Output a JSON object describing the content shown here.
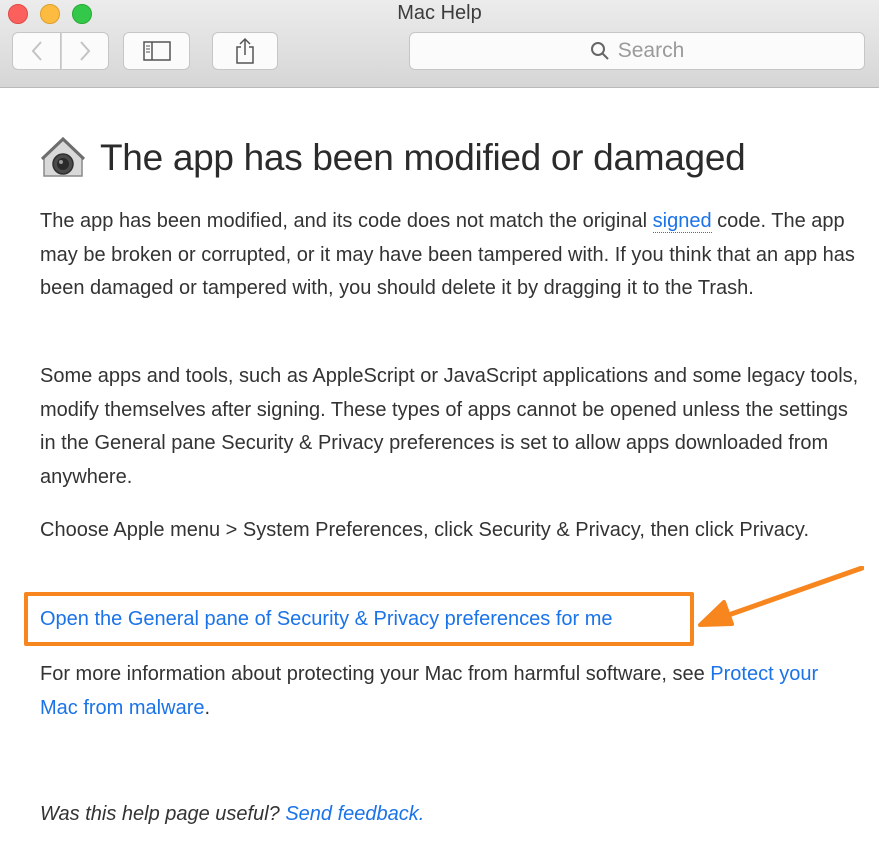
{
  "window": {
    "title": "Mac Help"
  },
  "toolbar": {
    "back_icon": "chevron-left-icon",
    "forward_icon": "chevron-right-icon",
    "sidebar_icon": "sidebar-icon",
    "share_icon": "share-icon",
    "search_placeholder": "Search"
  },
  "article": {
    "title": "The app has been modified or damaged",
    "title_icon": "gatekeeper-lock-icon",
    "p1_before": "The app has been modified, and its code does not match the original ",
    "p1_link": "signed",
    "p1_after": " code. The app may be broken or corrupted, or it may have been tampered with. If you think that an app has been damaged or tampered with, you should delete it by dragging it to the Trash.",
    "p2": "Some apps and tools, such as AppleScript or JavaScript applications and some legacy tools, modify themselves after signing. These types of apps cannot be opened unless the settings in the General pane Security & Privacy preferences is set to allow apps downloaded from anywhere.",
    "p3": "Choose Apple menu > System Preferences, click Security & Privacy, then click Privacy.",
    "open_link": "Open the General pane of Security & Privacy preferences for me",
    "p4_before": "For more information about protecting your Mac from harmful software, see ",
    "p4_link": "Protect your Mac from malware",
    "p4_after": ".",
    "feedback_question": "Was this help page useful? ",
    "feedback_link": "Send feedback."
  },
  "annotation": {
    "color": "#f7861f"
  },
  "colors": {
    "link": "#1a73e8",
    "accent": "#f7861f"
  }
}
